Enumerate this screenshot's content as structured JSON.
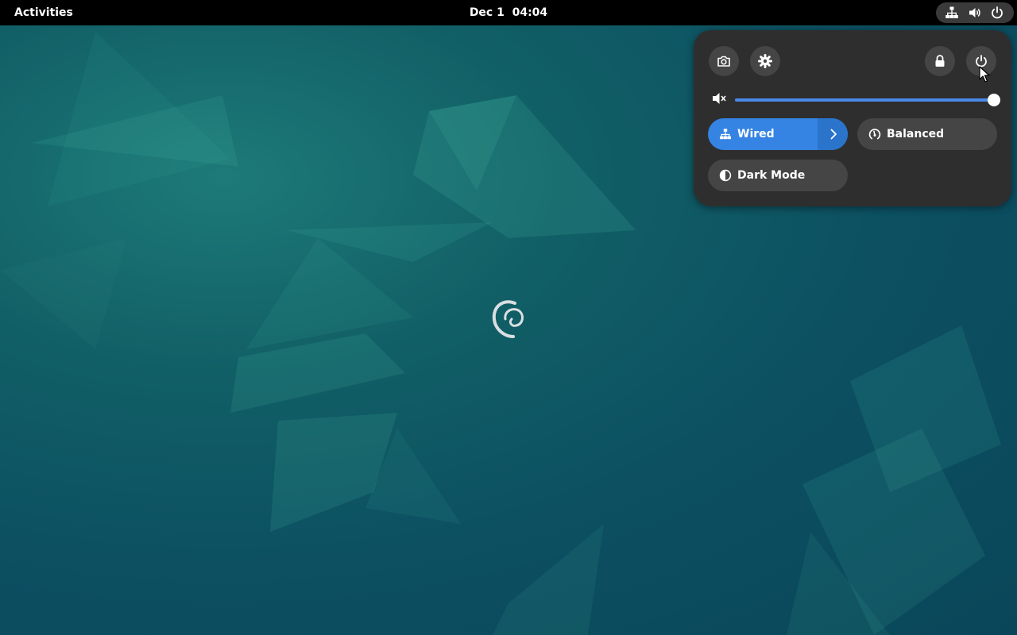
{
  "topbar": {
    "activities_label": "Activities",
    "clock_date": "Dec 1",
    "clock_time": "04:04",
    "status_icons": [
      "network-wired-icon",
      "speaker-icon",
      "power-icon"
    ]
  },
  "quick_settings": {
    "top_buttons": {
      "screenshot": "camera-icon",
      "settings": "gear-icon",
      "lock": "lock-icon",
      "power": "power-icon"
    },
    "volume": {
      "icon": "speaker-muted-icon",
      "level_percent": 100
    },
    "toggles": {
      "wired": {
        "label": "Wired",
        "active": true,
        "icon": "network-wired-icon",
        "has_submenu": true
      },
      "balanced": {
        "label": "Balanced",
        "active": false,
        "icon": "power-profile-icon"
      },
      "dark_mode": {
        "label": "Dark Mode",
        "active": false,
        "icon": "half-circle-icon"
      }
    }
  },
  "colors": {
    "accent": "#3584e4",
    "panel_bg": "#2e2e2e",
    "button_bg": "#454545",
    "topbar_bg": "#000000",
    "desktop_base": "#0c5062"
  }
}
